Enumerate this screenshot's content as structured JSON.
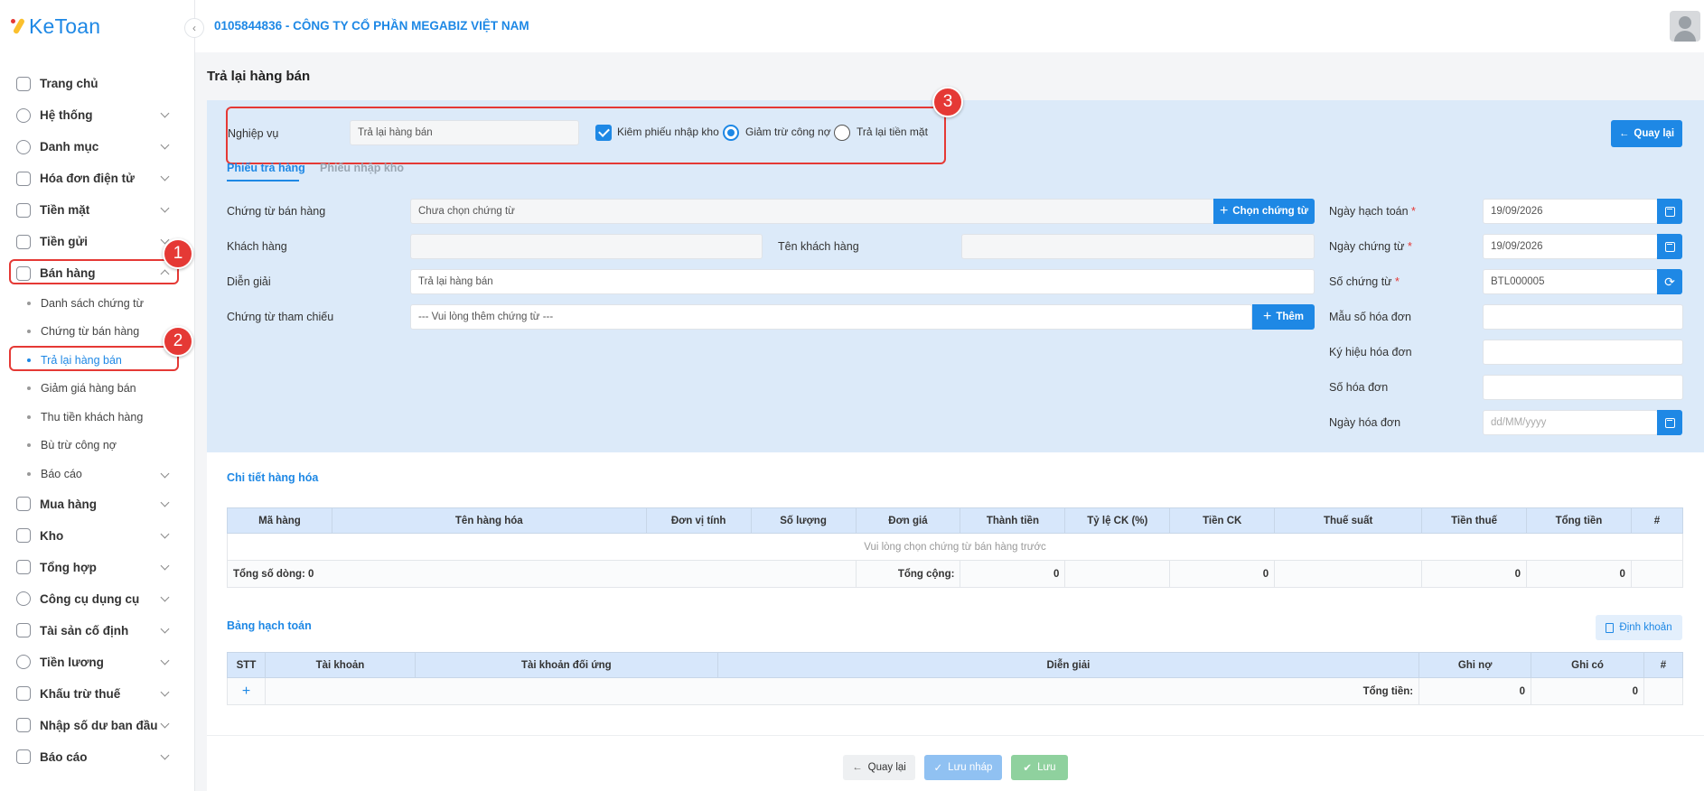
{
  "app": {
    "logo_text": "KeToan",
    "company": "0105844836 - CÔNG TY CỔ PHẦN MEGABIZ VIỆT NAM"
  },
  "sidebar": {
    "items": [
      {
        "label": "Trang chủ",
        "icon": "home-icon"
      },
      {
        "label": "Hệ thống",
        "icon": "gear-icon"
      },
      {
        "label": "Danh mục",
        "icon": "grid-icon"
      },
      {
        "label": "Hóa đơn điện tử",
        "icon": "invoice-icon"
      },
      {
        "label": "Tiền mặt",
        "icon": "cash-icon"
      },
      {
        "label": "Tiền gửi",
        "icon": "bank-icon"
      },
      {
        "label": "Bán hàng",
        "icon": "sales-icon"
      },
      {
        "label": "Mua hàng",
        "icon": "cart-icon"
      },
      {
        "label": "Kho",
        "icon": "warehouse-icon"
      },
      {
        "label": "Tổng hợp",
        "icon": "chart-icon"
      },
      {
        "label": "Công cụ dụng cụ",
        "icon": "tools-icon"
      },
      {
        "label": "Tài sản cố định",
        "icon": "asset-icon"
      },
      {
        "label": "Tiền lương",
        "icon": "salary-icon"
      },
      {
        "label": "Khấu trừ thuế",
        "icon": "tax-icon"
      },
      {
        "label": "Nhập số dư ban đầu",
        "icon": "balance-icon"
      },
      {
        "label": "Báo cáo",
        "icon": "report-icon"
      }
    ],
    "sub_items": [
      "Danh sách chứng từ",
      "Chứng từ bán hàng",
      "Trả lại hàng bán",
      "Giảm giá hàng bán",
      "Thu tiền khách hàng",
      "Bù trừ công nợ",
      "Báo cáo"
    ]
  },
  "annotations": [
    "1",
    "2",
    "3"
  ],
  "page": {
    "title": "Trả lại hàng bán"
  },
  "form": {
    "nghiep_vu_label": "Nghiệp vụ",
    "nghiep_vu_value": "Trả lại hàng bán",
    "kiem_phieu_label": "Kiêm phiếu nhập kho",
    "giam_tru_label": "Giảm trừ công nợ",
    "tra_lai_tien_label": "Trả lại tiền mặt",
    "back_label": "Quay lại",
    "tabs": [
      "Phiếu trả hàng",
      "Phiếu nhập kho"
    ],
    "chung_tu_ban_hang_label": "Chứng từ bán hàng",
    "chung_tu_ban_hang_value": "Chưa chọn chứng từ",
    "chon_chung_tu_label": "Chọn chứng từ",
    "khach_hang_label": "Khách hàng",
    "ten_khach_hang_label": "Tên khách hàng",
    "dien_giai_label": "Diễn giải",
    "dien_giai_value": "Trả lại hàng bán",
    "tham_chieu_label": "Chứng từ tham chiếu",
    "tham_chieu_placeholder": "--- Vui lòng thêm chứng từ ---",
    "them_label": "Thêm",
    "ngay_hach_toan_label": "Ngày hạch toán",
    "ngay_hach_toan_value": "19/09/2026",
    "ngay_chung_tu_label": "Ngày chứng từ",
    "ngay_chung_tu_value": "19/09/2026",
    "so_chung_tu_label": "Số chứng từ",
    "so_chung_tu_value": "BTL000005",
    "mau_so_label": "Mẫu số hóa đơn",
    "ky_hieu_label": "Ký hiệu hóa đơn",
    "so_hoa_don_label": "Số hóa đơn",
    "ngay_hoa_don_label": "Ngày hóa đơn",
    "ngay_hoa_don_placeholder": "dd/MM/yyyy",
    "required_mark": "*"
  },
  "goods": {
    "title": "Chi tiết hàng hóa",
    "columns": [
      "Mã hàng",
      "Tên hàng hóa",
      "Đơn vị tính",
      "Số lượng",
      "Đơn giá",
      "Thành tiền",
      "Tỷ lệ CK (%)",
      "Tiền CK",
      "Thuế suất",
      "Tiền thuế",
      "Tổng tiền",
      "#"
    ],
    "empty_message": "Vui lòng chọn chứng từ bán hàng trước",
    "row_count_label": "Tổng số dòng: 0",
    "total_label": "Tổng cộng:",
    "total_thanh_tien": "0",
    "total_tien_ck": "0",
    "total_tien_thue": "0",
    "total_tong_tien": "0"
  },
  "ledger": {
    "title": "Bảng hạch toán",
    "dinh_khoan_label": "Định khoản",
    "columns": [
      "STT",
      "Tài khoản",
      "Tài khoản đối ứng",
      "Diễn giải",
      "Ghi nợ",
      "Ghi có",
      "#"
    ],
    "add_symbol": "+",
    "total_label": "Tổng tiền:",
    "total_no": "0",
    "total_co": "0"
  },
  "footer": {
    "back": "Quay lại",
    "save_draft": "Lưu nháp",
    "save": "Lưu"
  },
  "colors": {
    "primary": "#1e88e5",
    "annotation": "#e53935",
    "success": "#66bb6a",
    "form_bg": "#dceaf9"
  }
}
